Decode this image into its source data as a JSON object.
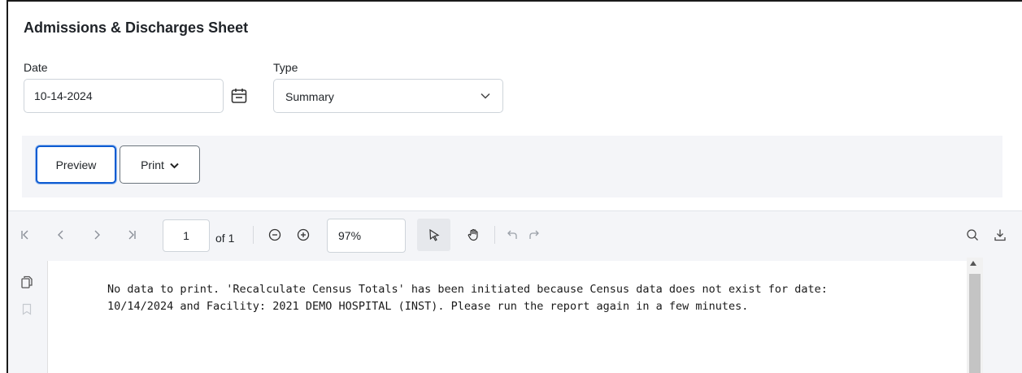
{
  "page": {
    "title": "Admissions & Discharges Sheet"
  },
  "form": {
    "date_label": "Date",
    "date_value": "10-14-2024",
    "type_label": "Type",
    "type_value": "Summary"
  },
  "actions": {
    "preview_label": "Preview",
    "print_label": "Print"
  },
  "viewer_toolbar": {
    "current_page": "1",
    "page_count_label": "of 1",
    "zoom": "97%",
    "icons": [
      "first-page-icon",
      "prev-page-icon",
      "next-page-icon",
      "last-page-icon",
      "zoom-out-icon",
      "zoom-in-icon",
      "select-tool-icon",
      "pan-hand-icon",
      "undo-icon",
      "redo-icon",
      "search-icon",
      "download-icon"
    ]
  },
  "sidebar": {
    "icons": [
      "thumbnails-icon",
      "bookmark-icon"
    ]
  },
  "document": {
    "lines": [
      "No data to print. 'Recalculate Census Totals' has been initiated because Census data does not exist for date:",
      "10/14/2024 and Facility: 2021 DEMO HOSPITAL (INST). Please run the report again in a few minutes."
    ]
  },
  "colors": {
    "accent": "#0d5bd1",
    "panel_bg": "#f4f5f8",
    "border": "#ced4da"
  }
}
